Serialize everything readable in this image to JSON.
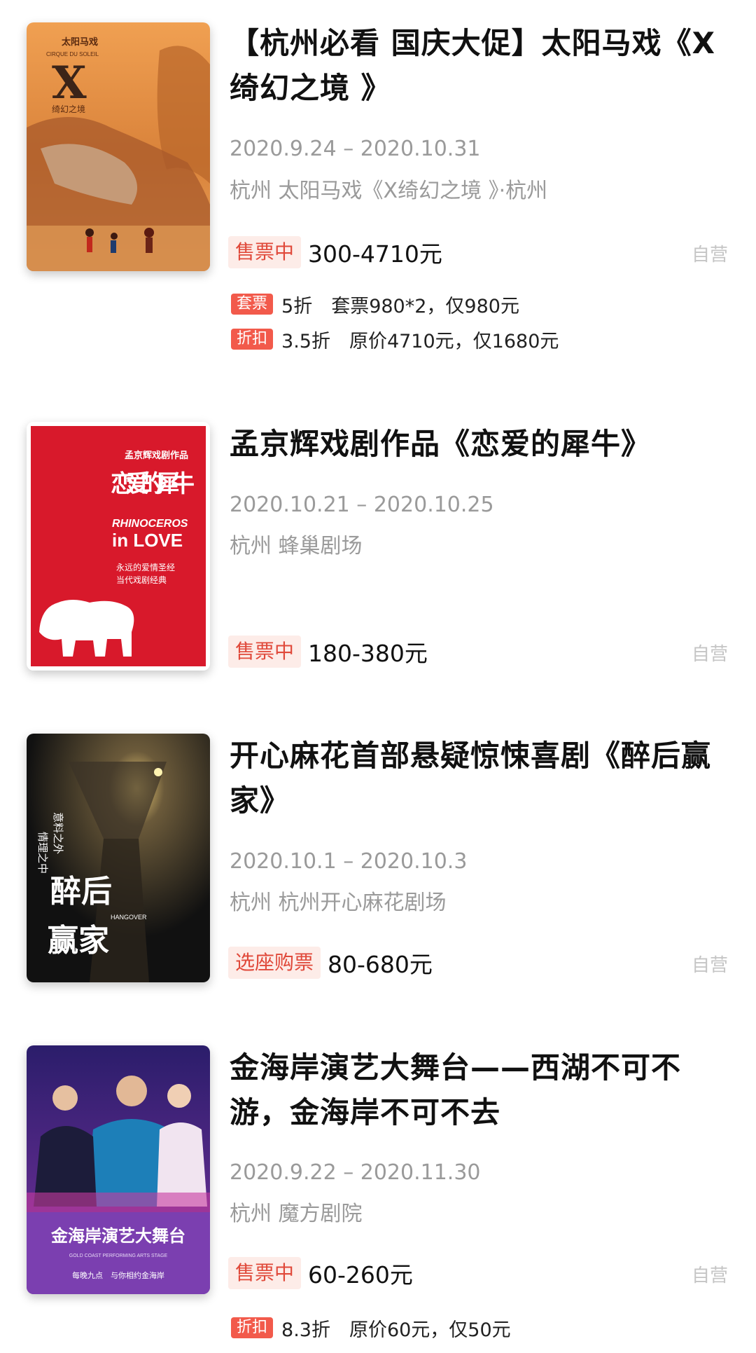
{
  "events": [
    {
      "title": "【杭州必看 国庆大促】太阳马戏《X绮幻之境 》",
      "dates": "2020.9.24 – 2020.10.31",
      "venue": "杭州 太阳马戏《X绮幻之境 》·杭州",
      "status": "售票中",
      "price": "300-4710元",
      "seller": "自营",
      "poster": {
        "brand": "太阳马戏",
        "sub": "CIRQUE DU SOLEIL",
        "mark": "X",
        "name": "绮幻之境"
      },
      "promos": [
        {
          "tag": "套票",
          "text": "5折　套票980*2，仅980元"
        },
        {
          "tag": "折扣",
          "text": "3.5折　原价4710元，仅1680元"
        }
      ]
    },
    {
      "title": "孟京辉戏剧作品《恋爱的犀牛》",
      "dates": "2020.10.21 – 2020.10.25",
      "venue": "杭州 蜂巢剧场",
      "status": "售票中",
      "price": "180-380元",
      "seller": "自营",
      "poster": {
        "top": "孟京辉戏剧作品",
        "title": "恋爱的犀牛",
        "en1": "RHINOCEROS",
        "en2": "in LOVE",
        "line1": "永远的爱情圣经",
        "line2": "当代戏剧经典"
      },
      "promos": []
    },
    {
      "title": "开心麻花首部悬疑惊悚喜剧《醉后赢家》",
      "dates": "2020.10.1 – 2020.10.3",
      "venue": "杭州 杭州开心麻花剧场",
      "status": "选座购票",
      "price": "80-680元",
      "seller": "自营",
      "poster": {
        "side1": "意料之外",
        "side2": "情理之中",
        "t1": "醉后",
        "t2": "赢家",
        "en": "HANGOVER"
      },
      "promos": []
    },
    {
      "title": "金海岸演艺大舞台——西湖不可不游，金海岸不可不去",
      "dates": "2020.9.22 – 2020.11.30",
      "venue": "杭州 魔方剧院",
      "status": "售票中",
      "price": "60-260元",
      "seller": "自营",
      "poster": {
        "title": "金海岸演艺大舞台",
        "en": "GOLD COAST PERFORMING ARTS STAGE",
        "slogan": "每晚九点　与你相约金海岸"
      },
      "promos": [
        {
          "tag": "折扣",
          "text": "8.3折　原价60元，仅50元"
        }
      ]
    }
  ],
  "colors": {
    "accent": "#e0493a",
    "badge_bg": "#fdece8",
    "tag_bg": "#f25a4b",
    "muted": "#9a9a9a"
  }
}
